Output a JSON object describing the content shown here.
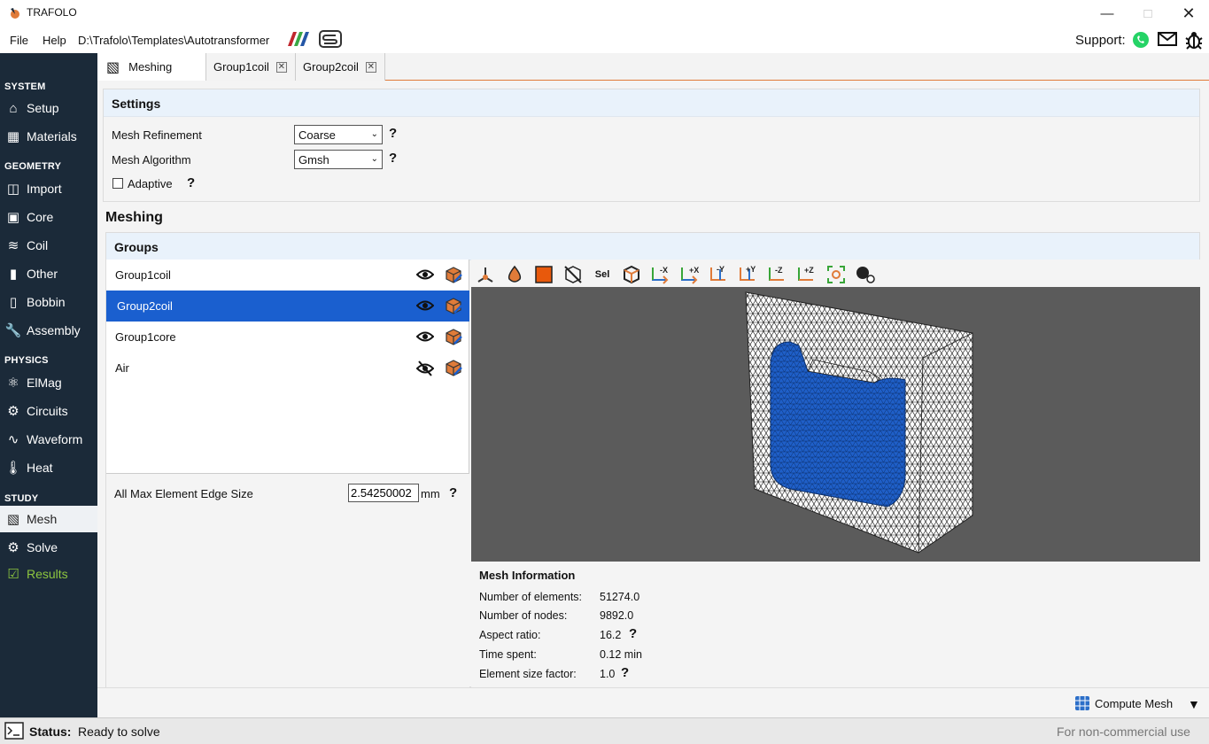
{
  "app": {
    "title": "TRAFOLO"
  },
  "menu": {
    "file": "File",
    "help": "Help",
    "path": "D:\\Trafolo\\Templates\\Autotransformer",
    "support_label": "Support:"
  },
  "sidebar": {
    "sections": {
      "system": "SYSTEM",
      "geometry": "GEOMETRY",
      "physics": "PHYSICS",
      "study": "STUDY"
    },
    "items": {
      "setup": "Setup",
      "materials": "Materials",
      "import": "Import",
      "core": "Core",
      "coil": "Coil",
      "other": "Other",
      "bobbin": "Bobbin",
      "assembly": "Assembly",
      "elmag": "ElMag",
      "circuits": "Circuits",
      "waveform": "Waveform",
      "heat": "Heat",
      "mesh": "Mesh",
      "solve": "Solve",
      "results": "Results"
    }
  },
  "tabs": {
    "meshing": "Meshing",
    "group1coil": "Group1coil",
    "group2coil": "Group2coil"
  },
  "settings": {
    "title": "Settings",
    "mesh_refinement_label": "Mesh Refinement",
    "mesh_refinement_value": "Coarse",
    "mesh_algorithm_label": "Mesh Algorithm",
    "mesh_algorithm_value": "Gmsh",
    "adaptive_label": "Adaptive",
    "help": "?"
  },
  "meshing": {
    "title": "Meshing",
    "groups_title": "Groups"
  },
  "groups": [
    {
      "name": "Group1coil",
      "visible": true,
      "color": "#e07b39"
    },
    {
      "name": "Group2coil",
      "visible": true,
      "color": "#e07b39"
    },
    {
      "name": "Group1core",
      "visible": true,
      "color": "#e07b39"
    },
    {
      "name": "Air",
      "visible": false,
      "color": "#e07b39"
    }
  ],
  "edge_size": {
    "label": "All Max Element Edge Size",
    "value": "2.54250002",
    "unit": "mm"
  },
  "viewer_toolbar": {
    "sel": "Sel",
    "mx": "-X",
    "px": "+X",
    "my": "-Y",
    "py": "+Y",
    "mz": "-Z",
    "pz": "+Z"
  },
  "mesh_info": {
    "title": "Mesh Information",
    "rows": [
      {
        "label": "Number of elements:",
        "value": "51274.0"
      },
      {
        "label": "Number of nodes:",
        "value": "9892.0"
      },
      {
        "label": "Aspect ratio:",
        "value": "16.2"
      },
      {
        "label": "Time spent:",
        "value": "0.12 min"
      },
      {
        "label": "Element size factor:",
        "value": "1.0"
      }
    ]
  },
  "bottom": {
    "compute_mesh": "Compute Mesh"
  },
  "status": {
    "label": "Status:",
    "text": "Ready to solve",
    "license": "For non-commercial use"
  },
  "colors": {
    "sidebar": "#1b2a39",
    "accent": "#e07b39",
    "selection": "#1a5fcf",
    "results": "#8dc63f",
    "mesh_blue": "#1f5fc8"
  }
}
